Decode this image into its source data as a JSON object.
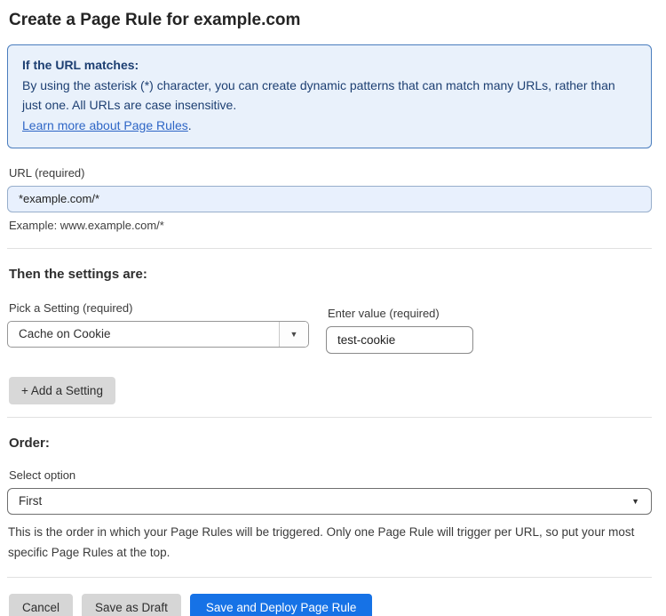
{
  "page": {
    "title": "Create a Page Rule for example.com"
  },
  "info_box": {
    "heading": "If the URL matches:",
    "body": "By using the asterisk (*) character, you can create dynamic patterns that can match many URLs, rather than just one. All URLs are case insensitive.",
    "link_label": "Learn more about Page Rules",
    "link_suffix": "."
  },
  "url_field": {
    "label": "URL (required)",
    "value": "*example.com/*",
    "example": "Example: www.example.com/*"
  },
  "settings_section": {
    "heading": "Then the settings are:",
    "setting_label": "Pick a Setting (required)",
    "setting_value": "Cache on Cookie",
    "value_label": "Enter value (required)",
    "value_value": "test-cookie",
    "add_button_label": "+ Add a Setting"
  },
  "order_section": {
    "heading": "Order:",
    "select_label": "Select option",
    "select_value": "First",
    "help_text": "This is the order in which your Page Rules will be triggered. Only one Page Rule will trigger per URL, so put your most specific Page Rules at the top."
  },
  "footer": {
    "cancel_label": "Cancel",
    "save_draft_label": "Save as Draft",
    "save_deploy_label": "Save and Deploy Page Rule"
  },
  "icons": {
    "dropdown_arrow": "▼"
  },
  "colors": {
    "info_bg": "#e9f1fb",
    "info_border": "#4a7dbe",
    "info_text": "#1d3f72",
    "link_blue": "#2e66c6",
    "url_input_bg": "#e8f0fd",
    "primary_button_blue": "#1672e6",
    "gray_button": "#d6d6d6"
  }
}
